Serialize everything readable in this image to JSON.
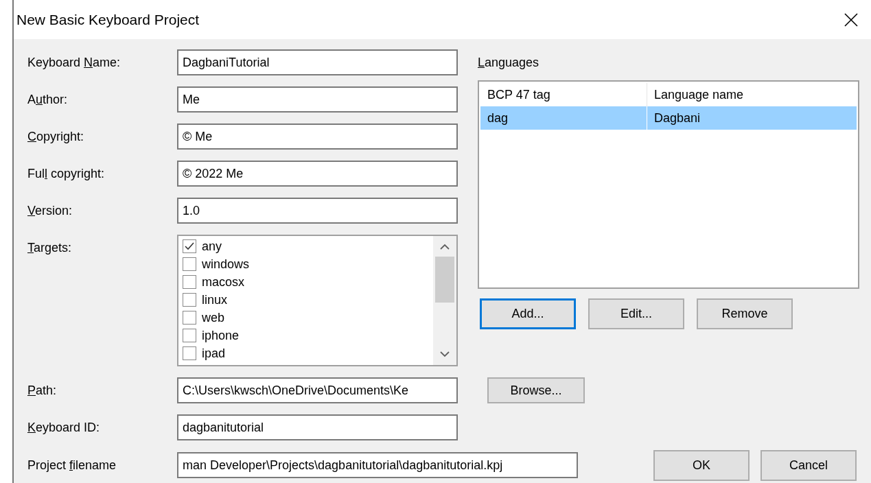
{
  "window": {
    "title": "New Basic Keyboard Project"
  },
  "fields": [
    {
      "label": {
        "before": "Keyboard ",
        "key": "N",
        "after": "ame:"
      },
      "value": "DagbaniTutorial"
    },
    {
      "label": {
        "before": "A",
        "key": "u",
        "after": "thor:"
      },
      "value": "Me"
    },
    {
      "label": {
        "key": "C",
        "after": "opyright:"
      },
      "value": "© Me"
    },
    {
      "label": {
        "before": "Ful",
        "key": "l",
        "after": " copyright:"
      },
      "value": "© 2022 Me"
    },
    {
      "label": {
        "key": "V",
        "after": "ersion:"
      },
      "value": "1.0"
    }
  ],
  "targets": {
    "label": {
      "key": "T",
      "after": "argets:"
    },
    "items": [
      {
        "label": "any",
        "checked": true
      },
      {
        "label": "windows",
        "checked": false
      },
      {
        "label": "macosx",
        "checked": false
      },
      {
        "label": "linux",
        "checked": false
      },
      {
        "label": "web",
        "checked": false
      },
      {
        "label": "iphone",
        "checked": false
      },
      {
        "label": "ipad",
        "checked": false
      }
    ]
  },
  "path": {
    "label": {
      "key": "P",
      "after": "ath:"
    },
    "value": "C:\\Users\\kwsch\\OneDrive\\Documents\\Ke",
    "button": "Browse..."
  },
  "keyboard_id": {
    "label": {
      "key": "K",
      "after": "eyboard ID:"
    },
    "value": "dagbanitutorial"
  },
  "project_filename": {
    "label": {
      "before": "Project ",
      "key": "f",
      "after": "ilename"
    },
    "value": "man Developer\\Projects\\dagbanitutorial\\dagbanitutorial.kpj"
  },
  "languages": {
    "label": {
      "key": "L",
      "after": "anguages"
    },
    "columns": [
      "BCP 47 tag",
      "Language name"
    ],
    "rows": [
      {
        "cells": [
          "dag",
          "Dagbani"
        ],
        "selected": true
      }
    ],
    "buttons": [
      {
        "label": "Add...",
        "focused": true
      },
      {
        "label": "Edit...",
        "focused": false
      },
      {
        "label": "Remove",
        "focused": false
      }
    ]
  },
  "dialog_buttons": [
    {
      "label": "OK",
      "focused": false
    },
    {
      "label": "Cancel",
      "focused": false
    }
  ]
}
